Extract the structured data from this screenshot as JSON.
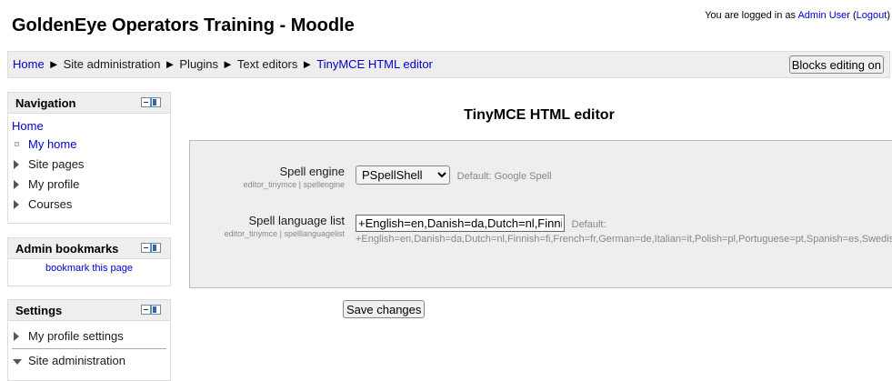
{
  "header": {
    "site_title": "GoldenEye Operators Training - Moodle",
    "login_prefix": "You are logged in as ",
    "user_name": "Admin User",
    "logout_open": " (",
    "logout_label": "Logout",
    "logout_close": ")"
  },
  "breadcrumb": {
    "separator": "►",
    "items": [
      "Home",
      "Site administration",
      "Plugins",
      "Text editors",
      "TinyMCE HTML editor"
    ]
  },
  "blocks_editing_button": "Blocks editing on",
  "navigation": {
    "title": "Navigation",
    "home": "Home",
    "items": [
      "My home",
      "Site pages",
      "My profile",
      "Courses"
    ]
  },
  "admin_bookmarks": {
    "title": "Admin bookmarks",
    "link": "bookmark this page"
  },
  "settings_block": {
    "title": "Settings",
    "items": [
      "My profile settings",
      "Site administration"
    ]
  },
  "page": {
    "heading": "TinyMCE HTML editor",
    "spell_engine": {
      "label": "Spell engine",
      "key": "editor_tinymce | spellengine",
      "selected": "PSpellShell",
      "default": "Default: Google Spell"
    },
    "spell_language": {
      "label": "Spell language list",
      "key": "editor_tinymce | spelllanguagelist",
      "value": "+English=en,Danish=da,Dutch=nl,Finnish=fi,French=fr,German=de,Italian=it,Polish=pl,Portuguese=pt,Spanish=es,Swedish=sv",
      "default_label": "Default:",
      "default_value": "+English=en,Danish=da,Dutch=nl,Finnish=fi,French=fr,German=de,Italian=it,Polish=pl,Portuguese=pt,Spanish=es,Swedish=sv"
    },
    "save_button": "Save changes"
  }
}
